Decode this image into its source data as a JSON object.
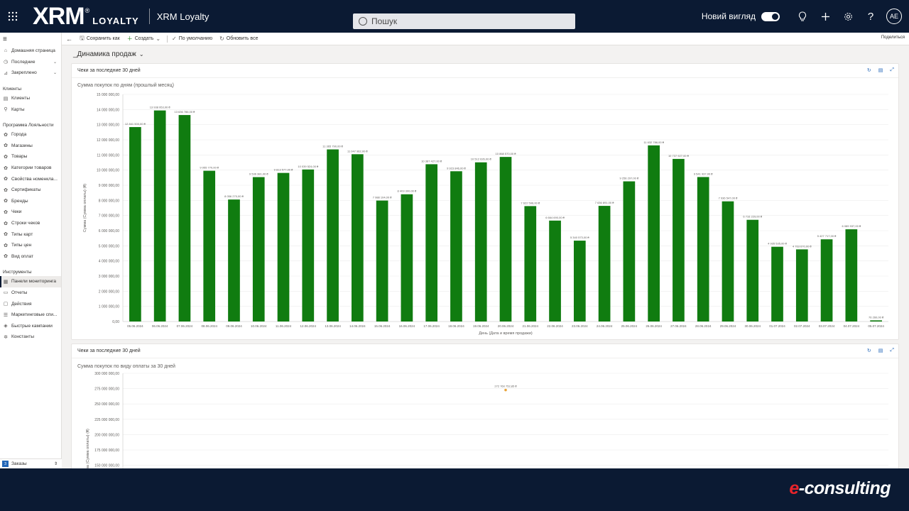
{
  "header": {
    "brand_main": "XRM",
    "brand_reg": "®",
    "brand_sub": "LOYALTY",
    "app_name": "XRM Loyalty",
    "search_placeholder": "Пошук",
    "new_look_label": "Новий вигляд",
    "new_look_on": true,
    "avatar_initials": "AE"
  },
  "commandbar": {
    "save_as": "Сохранить как",
    "create": "Создать",
    "default": "По умолчанию",
    "refresh_all": "Обновить все",
    "share": "Поделиться"
  },
  "sidebar": {
    "top": [
      {
        "label": "Домашняя страница",
        "icon": "home-icon"
      },
      {
        "label": "Последние",
        "icon": "clock-icon"
      },
      {
        "label": "Закреплено",
        "icon": "pin-icon"
      }
    ],
    "sections": [
      {
        "title": "Клиенты",
        "items": [
          {
            "label": "Клиенты",
            "icon": "contact-icon"
          },
          {
            "label": "Карты",
            "icon": "card-icon"
          }
        ]
      },
      {
        "title": "Программа Лояльности",
        "items": [
          {
            "label": "Города",
            "icon": "entity-icon"
          },
          {
            "label": "Магазины",
            "icon": "entity-icon"
          },
          {
            "label": "Товары",
            "icon": "entity-icon"
          },
          {
            "label": "Категории товаров",
            "icon": "entity-icon"
          },
          {
            "label": "Свойства номенкла...",
            "icon": "entity-icon"
          },
          {
            "label": "Сертификаты",
            "icon": "entity-icon"
          },
          {
            "label": "Бренды",
            "icon": "entity-icon"
          },
          {
            "label": "Чеки",
            "icon": "entity-icon"
          },
          {
            "label": "Строки чеков",
            "icon": "entity-icon"
          },
          {
            "label": "Типы карт",
            "icon": "entity-icon"
          },
          {
            "label": "Типы цен",
            "icon": "entity-icon"
          },
          {
            "label": "Вид оплат",
            "icon": "entity-icon"
          }
        ]
      },
      {
        "title": "Инструменты",
        "items": [
          {
            "label": "Панели мониторинга",
            "icon": "dashboard-icon",
            "active": true
          },
          {
            "label": "Отчеты",
            "icon": "report-icon"
          },
          {
            "label": "Действия",
            "icon": "activity-icon"
          },
          {
            "label": "Маркетинговые спи...",
            "icon": "list-icon"
          },
          {
            "label": "Быстрые кампании",
            "icon": "campaign-icon"
          },
          {
            "label": "Константы",
            "icon": "settings-icon"
          }
        ]
      }
    ],
    "area_badge": "З",
    "area_label": "Заказы"
  },
  "dashboard": {
    "title": "_Динамика продаж"
  },
  "card1": {
    "header": "Чеки за последние 30 дней",
    "subtitle": "Сумма покупок по дням (прошлый месяц)"
  },
  "card2": {
    "header": "Чеки за последние 30 дней",
    "subtitle": "Сумма покупок по виду оплаты за 30 дней"
  },
  "chart_data": [
    {
      "type": "bar",
      "title": "Сумма покупок по дням (прошлый месяц)",
      "xlabel": "День (Дата и время продажи)",
      "ylabel": "Сумма (Сумма оплаты) (₴)",
      "ylim": [
        0,
        15000000
      ],
      "yticks": [
        "0,00",
        "1 000 000,00",
        "2 000 000,00",
        "3 000 000,00",
        "4 000 000,00",
        "5 000 000,00",
        "6 000 000,00",
        "7 000 000,00",
        "8 000 000,00",
        "9 000 000,00",
        "10 000 000,00",
        "11 000 000,00",
        "12 000 000,00",
        "13 000 000,00",
        "14 000 000,00",
        "15 000 000,00"
      ],
      "grid": true,
      "bar_color": "#107c10",
      "categories": [
        "05.06.2024",
        "06.06.2024",
        "07.06.2024",
        "08.06.2024",
        "09.06.2024",
        "10.06.2024",
        "11.06.2024",
        "12.06.2024",
        "13.06.2024",
        "14.06.2024",
        "15.06.2024",
        "16.06.2024",
        "17.06.2024",
        "18.06.2024",
        "19.06.2024",
        "20.06.2024",
        "21.06.2024",
        "22.06.2024",
        "23.06.2024",
        "24.06.2024",
        "25.06.2024",
        "26.06.2024",
        "27.06.2024",
        "28.06.2024",
        "29.06.2024",
        "30.06.2024",
        "01.07.2024",
        "02.07.2024",
        "03.07.2024",
        "04.07.2024",
        "05.07.2024"
      ],
      "values": [
        12841500,
        13938953,
        13636786,
        9955770,
        8056270,
        9536381,
        9813577,
        10039524,
        11365790,
        11047962,
        7988104,
        8403300,
        10387427,
        9923846,
        10512626,
        10868570,
        7622596,
        6664690,
        5340573,
        7636891,
        9256297,
        11632786,
        10737927,
        9541937,
        7936547,
        6716229,
        4935535,
        4763670,
        5427717,
        6089937,
        76260
      ],
      "data_labels": [
        "12 841 500,00 ₴",
        "13 938 953,00 ₴",
        "13 636 786,00 ₴",
        "9 955 770,00 ₴",
        "8 056 270,00 ₴",
        "9 536 381,00 ₴",
        "9 813 577,00 ₴",
        "10 039 524,00 ₴",
        "11 365 790,00 ₴",
        "11 047 962,00 ₴",
        "7 988 104,00 ₴",
        "8 403 300,00 ₴",
        "10 387 427,00 ₴",
        "9 923 846,00 ₴",
        "10 512 626,00 ₴",
        "10 868 570,00 ₴",
        "7 622 596,00 ₴",
        "6 664 690,00 ₴",
        "5 340 573,00 ₴",
        "7 636 891,00 ₴",
        "9 256 297,00 ₴",
        "11 632 786,00 ₴",
        "10 737 927,00 ₴",
        "9 541 937,00 ₴",
        "7 936 547,00 ₴",
        "6 716 229,00 ₴",
        "4 935 535,00 ₴",
        "4 763 670,00 ₴",
        "5 427 717,00 ₴",
        "6 089 937,00 ₴",
        "76 260,00 ₴"
      ]
    },
    {
      "type": "scatter",
      "title": "Сумма покупок по виду оплаты за 30 дней",
      "ylabel": "ма (Сумма оплаты) (₴)",
      "ylim_visible": [
        150000000,
        300000000
      ],
      "yticks": [
        "150 000 000,00",
        "175 000 000,00",
        "200 000 000,00",
        "225 000 000,00",
        "250 000 000,00",
        "275 000 000,00",
        "300 000 000,00"
      ],
      "grid": true,
      "point_color": "#e8a33a",
      "values": [
        272760752.85
      ],
      "data_labels": [
        "272 760 752,85 ₴"
      ]
    }
  ],
  "footer": {
    "logo_e": "e",
    "logo_rest": "-consulting"
  }
}
